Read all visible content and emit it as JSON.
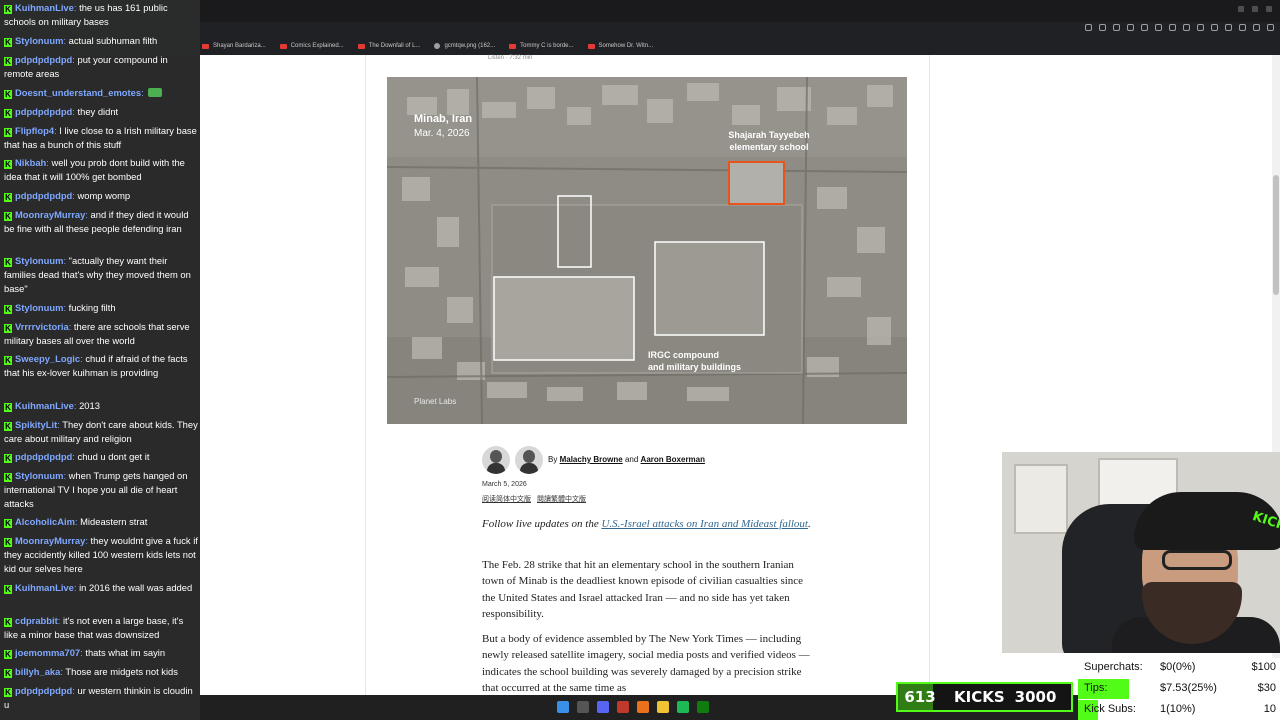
{
  "browser": {
    "bookmarks": [
      {
        "label": "Shayan Bardariza...",
        "icon": "youtube-icon"
      },
      {
        "label": "Comics Explained...",
        "icon": "youtube-icon"
      },
      {
        "label": "The Downfall of L...",
        "icon": "youtube-icon"
      },
      {
        "label": "gcmtqw.png (162...",
        "icon": "image-icon"
      },
      {
        "label": "Tommy C is borde...",
        "icon": "youtube-icon"
      },
      {
        "label": "Somehow Dr. Witn...",
        "icon": "youtube-icon"
      }
    ]
  },
  "article": {
    "listen": "Listen · 7:32 min",
    "figure": {
      "location": "Minab, Iran",
      "date": "Mar. 4, 2026",
      "school_label_line1": "Shajarah Tayyebeh",
      "school_label_line2": "elementary school",
      "irgc_label_line1": "IRGC compound",
      "irgc_label_line2": "and military buildings",
      "credit": "Planet Labs"
    },
    "byline_prefix": "By",
    "author1": "Malachy Browne",
    "byline_and": "and",
    "author2": "Aaron Boxerman",
    "date": "March 5, 2026",
    "lang1": "阅读简体中文版",
    "lang2": "閱讀繁體中文版",
    "live_prefix": "Follow live updates on the",
    "live_link": "U.S.-Israel attacks on Iran and Mideast fallout",
    "live_suffix": ".",
    "p1": "The Feb. 28 strike that hit an elementary school in the southern Iranian town of Minab is the deadliest known episode of civilian casualties since the United States and Israel attacked Iran — and no side has yet taken responsibility.",
    "p2": "But a body of evidence assembled by The New York Times — including newly released satellite imagery, social media posts and verified videos — indicates the school building was severely damaged by a precision strike that occurred at the same time as"
  },
  "chat": [
    {
      "user": "KuihmanLive",
      "text": "the us has 161 public schools on military bases",
      "color": "#7fa8ff"
    },
    {
      "user": "Stylonuum",
      "text": "actual subhuman filth",
      "color": "#7fa8ff"
    },
    {
      "user": "pdpdpdpdpd",
      "text": "put your compound in remote areas",
      "color": "#7fa8ff"
    },
    {
      "user": "Doesnt_understand_emotes",
      "text": "",
      "color": "#7fa8ff"
    },
    {
      "user": "pdpdpdpdpd",
      "text": "they didnt",
      "color": "#7fa8ff"
    },
    {
      "user": "Flipflop4",
      "text": "I live close to a Irish military base that has a bunch of this stuff",
      "color": "#7fa8ff"
    },
    {
      "user": "Nikbah",
      "text": "well you prob dont build with the idea that it will 100% get bombed",
      "color": "#7fa8ff"
    },
    {
      "user": "pdpdpdpdpd",
      "text": "womp womp",
      "color": "#7fa8ff"
    },
    {
      "user": "MoonrayMurray",
      "text": "and if they died it would be fine with all these people defending iran",
      "color": "#7fa8ff"
    },
    {
      "user": "Stylonuum",
      "text": "\"actually they want their families dead that's why they moved them on base\"",
      "color": "#7fa8ff"
    },
    {
      "user": "Stylonuum",
      "text": "fucking filth",
      "color": "#7fa8ff"
    },
    {
      "user": "Vrrrrvictoria",
      "text": "there are schools that serve military bases all over the world",
      "color": "#7fa8ff"
    },
    {
      "user": "Sweepy_Logic",
      "text": "chud if afraid of the facts that his ex-lover kuihman is providing",
      "color": "#7fa8ff"
    },
    {
      "user": "KuihmanLive",
      "text": "2013",
      "color": "#7fa8ff"
    },
    {
      "user": "SpikityLit",
      "text": "They don't care about kids. They care about military and religion",
      "color": "#7fa8ff"
    },
    {
      "user": "pdpdpdpdpd",
      "text": "chud u dont get it",
      "color": "#7fa8ff"
    },
    {
      "user": "Stylonuum",
      "text": "when Trump gets hanged on international TV I hope you all die of heart attacks",
      "color": "#7fa8ff"
    },
    {
      "user": "AlcoholicAim",
      "text": "Mideastern strat",
      "color": "#7fa8ff"
    },
    {
      "user": "MoonrayMurray",
      "text": "they wouldnt give a fuck if they accidently killed 100 western kids lets not kid our selves here",
      "color": "#7fa8ff"
    },
    {
      "user": "KuihmanLive",
      "text": "in 2016 the wall was added",
      "color": "#7fa8ff"
    },
    {
      "user": "cdprabbit",
      "text": "it's not even a large base, it's like a minor base that was downsized",
      "color": "#7fa8ff"
    },
    {
      "user": "joemomma707",
      "text": "thats what im sayin",
      "color": "#7fa8ff"
    },
    {
      "user": "billyh_aka",
      "text": "Those are midgets not kids",
      "color": "#7fa8ff"
    },
    {
      "user": "pdpdpdpdpd",
      "text": "ur western thinkin is cloudin u",
      "color": "#7fa8ff"
    }
  ],
  "counter": {
    "count": "613",
    "label": "KICKS",
    "goal": "3000",
    "fraction": 0.204
  },
  "stats": [
    {
      "name": "Superchats:",
      "value": "$0(0%)",
      "goal": "$100",
      "fraction": 0.0
    },
    {
      "name": "Tips:",
      "value": "$7.53(25%)",
      "goal": "$30",
      "fraction": 0.25
    },
    {
      "name": "Kick Subs:",
      "value": "1(10%)",
      "goal": "10",
      "fraction": 0.1
    }
  ],
  "colors": {
    "kick_green": "#53fc18",
    "link_blue": "#326891",
    "school_box": "#e8541c"
  }
}
